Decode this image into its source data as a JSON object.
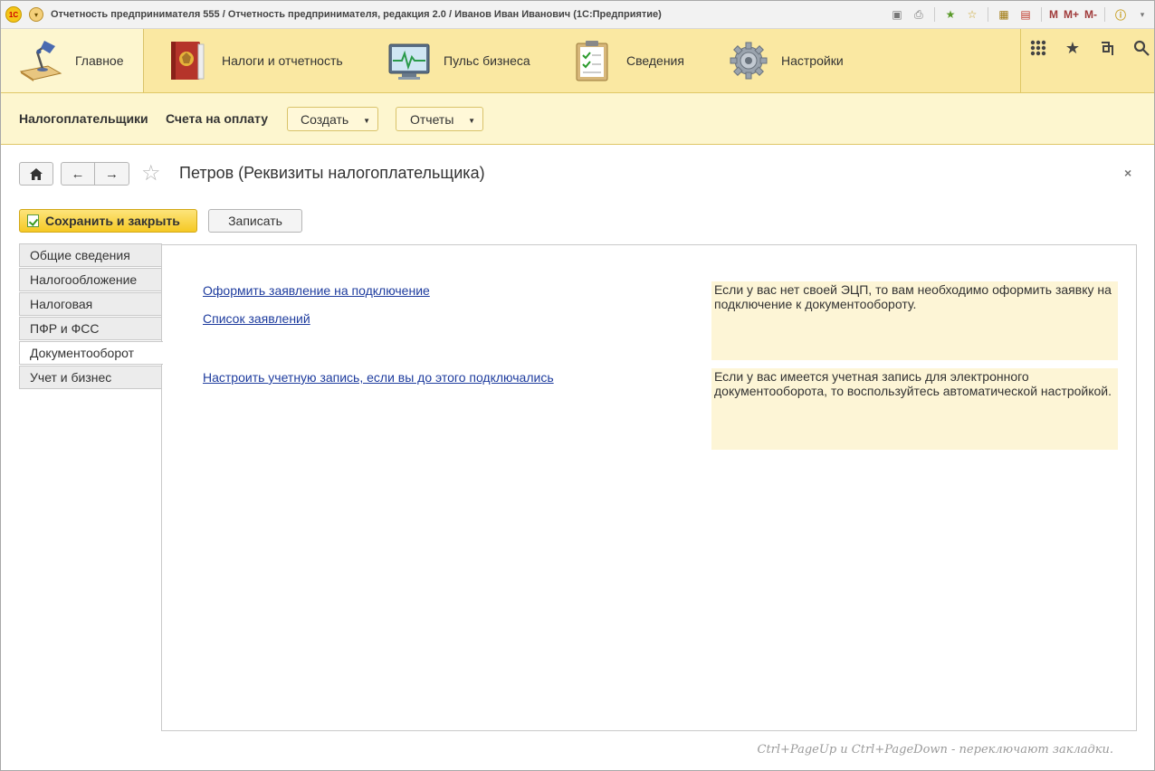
{
  "window": {
    "title": "Отчетность предпринимателя 555 / Отчетность предпринимателя, редакция 2.0 / Иванов Иван Иванович  (1С:Предприятие)",
    "logo_text": "1С",
    "toolbar_m": "M",
    "toolbar_mplus": "M+",
    "toolbar_mminus": "M-"
  },
  "sections": [
    {
      "label": "Главное",
      "icon": "desk-lamp-icon",
      "active": true
    },
    {
      "label": "Налоги и отчетность",
      "icon": "book-icon",
      "active": false
    },
    {
      "label": "Пульс бизнеса",
      "icon": "monitor-pulse-icon",
      "active": false
    },
    {
      "label": "Сведения",
      "icon": "clipboard-icon",
      "active": false
    },
    {
      "label": "Настройки",
      "icon": "gear-icon",
      "active": false
    }
  ],
  "functions": {
    "taxpayers": "Налогоплательщики",
    "invoices": "Счета на оплату",
    "create": "Создать",
    "reports": "Отчеты"
  },
  "form": {
    "title": "Петров (Реквизиты налогоплательщика)",
    "save_close": "Сохранить и закрыть",
    "write": "Записать",
    "close": "×"
  },
  "tabs": [
    {
      "label": "Общие сведения",
      "active": false
    },
    {
      "label": "Налогообложение",
      "active": false
    },
    {
      "label": "Налоговая",
      "active": false
    },
    {
      "label": "ПФР и ФСС",
      "active": false
    },
    {
      "label": "Документооборот",
      "active": true
    },
    {
      "label": "Учет и бизнес",
      "active": false
    }
  ],
  "content": {
    "link_apply": "Оформить заявление на подключение",
    "link_list": "Список заявлений",
    "link_setup": "Настроить учетную запись, если вы до этого подключались",
    "hint_1": "Если у вас нет своей ЭЦП, то вам необходимо оформить заявку на подключение к документообороту.",
    "hint_2": "Если у вас имеется учетная запись для электронного документооборота, то воспользуйтесь автоматической настройкой."
  },
  "footer_hint": "Ctrl+PageUp и Ctrl+PageDown - переключают закладки.",
  "colors": {
    "sections_bg": "#fae8a2",
    "functions_bg": "#fdf6cf",
    "link": "#1e3c9e",
    "hint_bg": "#fdf5d6"
  }
}
